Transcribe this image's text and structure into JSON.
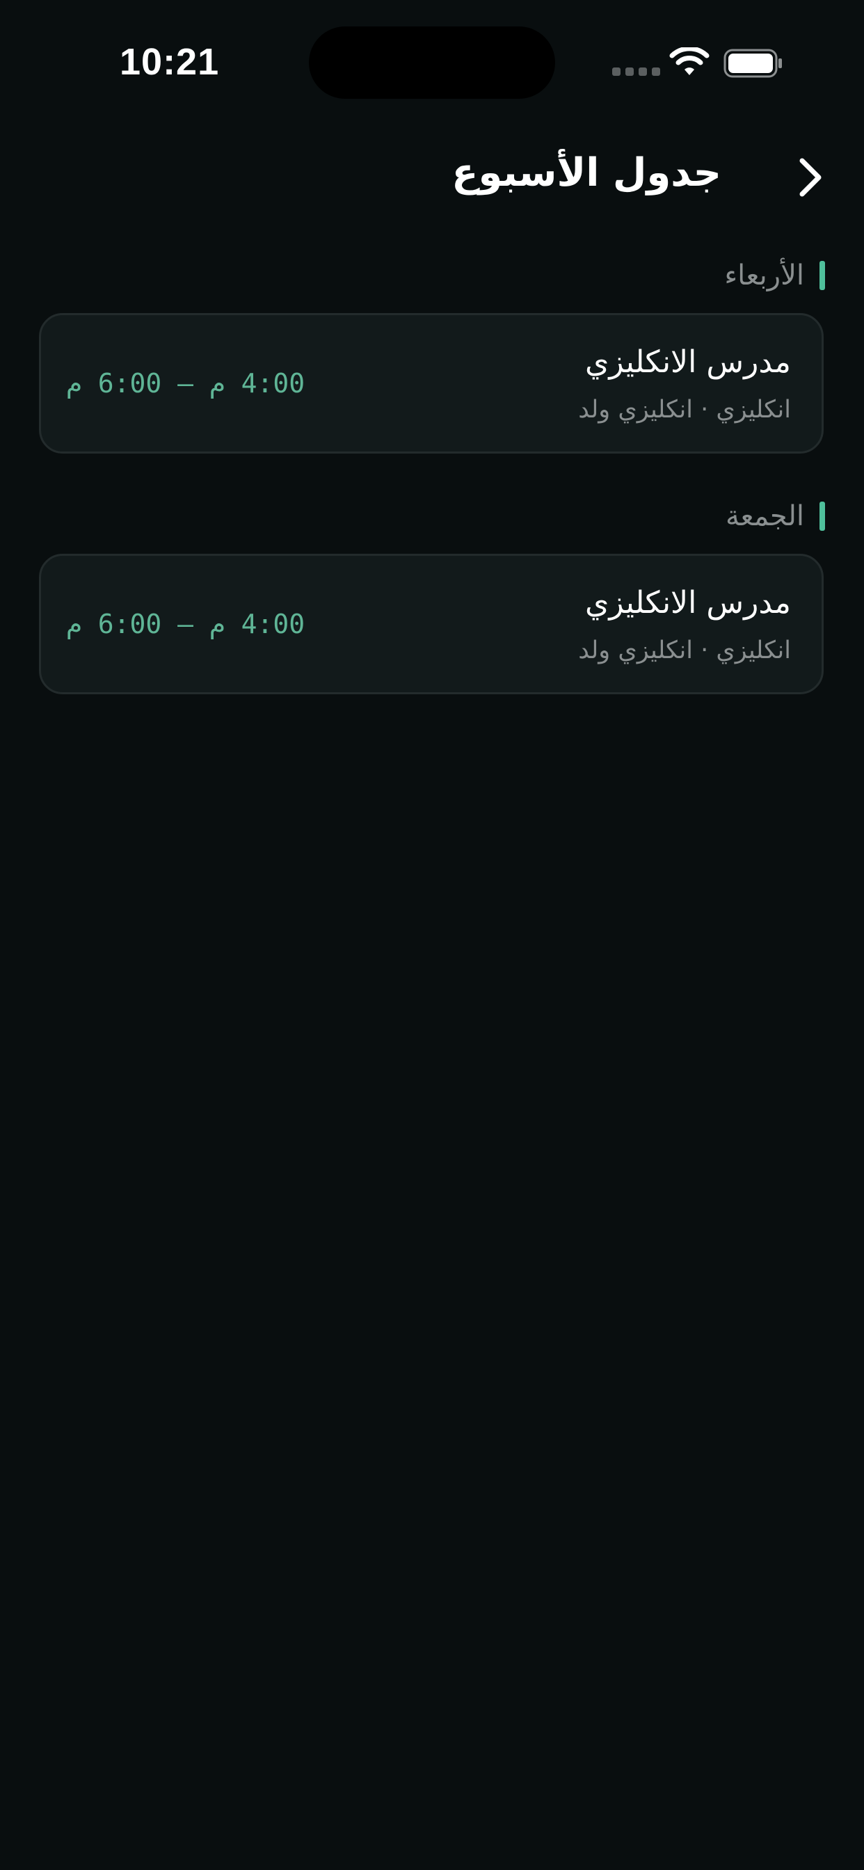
{
  "status_bar": {
    "time": "10:21",
    "icons": [
      "signal-dots-icon",
      "wifi-icon",
      "battery-icon"
    ]
  },
  "header": {
    "title": "جدول الأسبوع",
    "back_icon": "chevron-right-icon"
  },
  "days": [
    {
      "label": "الأربعاء",
      "classes": [
        {
          "teacher": "مدرس الانكليزي",
          "subtitle": "انكليزي · انكليزي ولد",
          "time": "4:00 م – 6:00 م"
        }
      ]
    },
    {
      "label": "الجمعة",
      "classes": [
        {
          "teacher": "مدرس الانكليزي",
          "subtitle": "انكليزي · انكليزي ولد",
          "time": "4:00 م – 6:00 م"
        }
      ]
    }
  ],
  "colors": {
    "background": "#090e0f",
    "card": "#121a1b",
    "card_border": "#232b2c",
    "accent": "#4fbf9b",
    "time_text": "#5fb596",
    "muted_text": "#8a8f90"
  }
}
